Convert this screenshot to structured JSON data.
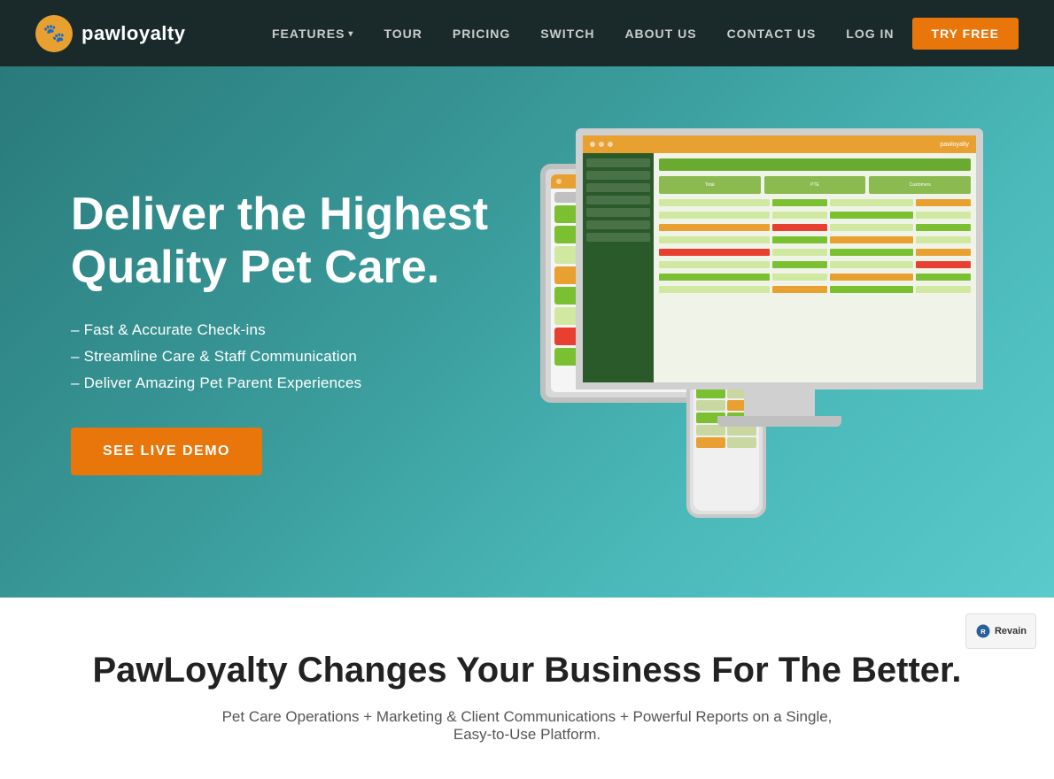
{
  "navbar": {
    "logo_text": "pawloyalty",
    "logo_icon": "🐾",
    "links": [
      {
        "label": "FEATURES",
        "has_dropdown": true
      },
      {
        "label": "TOUR",
        "has_dropdown": false
      },
      {
        "label": "PRICING",
        "has_dropdown": false
      },
      {
        "label": "SWITCH",
        "has_dropdown": false
      },
      {
        "label": "ABOUT US",
        "has_dropdown": false
      },
      {
        "label": "CONTACT US",
        "has_dropdown": false
      },
      {
        "label": "LOG IN",
        "has_dropdown": false
      }
    ],
    "cta_label": "TRY FREE"
  },
  "hero": {
    "title": "Deliver the Highest Quality Pet Care.",
    "features": [
      "– Fast & Accurate Check-ins",
      "– Streamline Care & Staff Communication",
      "– Deliver Amazing Pet Parent Experiences"
    ],
    "cta_label": "SEE LIVE DEMO"
  },
  "bottom": {
    "title": "PawLoyalty Changes Your Business For The Better.",
    "subtitle": "Pet Care Operations + Marketing & Client Communications + Powerful Reports on a Single, Easy-to-Use Platform."
  },
  "revain": {
    "label": "Revain"
  }
}
